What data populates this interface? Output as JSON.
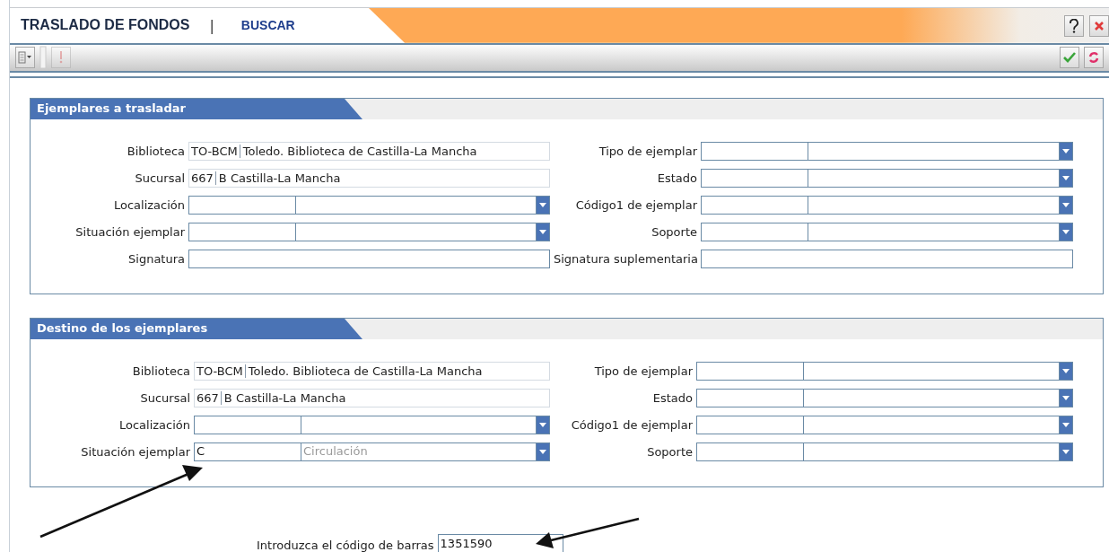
{
  "header": {
    "title": "TRASLADO DE FONDOS",
    "separator": "|",
    "link": "BUSCAR"
  },
  "sections": [
    {
      "title": "Ejemplares a trasladar",
      "left": [
        {
          "kind": "lookup",
          "label": "Biblioteca",
          "code": "TO-BCM",
          "value": "Toledo. Biblioteca de Castilla-La Mancha"
        },
        {
          "kind": "lookup",
          "label": "Sucursal",
          "code": "667",
          "value": "B Castilla-La Mancha"
        },
        {
          "kind": "combo",
          "label": "Localización"
        },
        {
          "kind": "combo",
          "label": "Situación ejemplar"
        },
        {
          "kind": "text",
          "label": "Signatura"
        }
      ],
      "right": [
        {
          "kind": "combo",
          "label": "Tipo de ejemplar"
        },
        {
          "kind": "combo",
          "label": "Estado"
        },
        {
          "kind": "combo",
          "label": "Código1 de ejemplar"
        },
        {
          "kind": "combo",
          "label": "Soporte"
        },
        {
          "kind": "text",
          "label": "Signatura suplementaria"
        }
      ]
    },
    {
      "title": "Destino de los ejemplares",
      "left": [
        {
          "kind": "lookup",
          "label": "Biblioteca",
          "code": "TO-BCM",
          "value": "Toledo. Biblioteca de Castilla-La Mancha"
        },
        {
          "kind": "lookup",
          "label": "Sucursal",
          "code": "667",
          "value": "B Castilla-La Mancha"
        },
        {
          "kind": "combo",
          "label": "Localización"
        },
        {
          "kind": "combo",
          "label": "Situación ejemplar",
          "code": "C",
          "value": "Circulación"
        }
      ],
      "right": [
        {
          "kind": "combo",
          "label": "Tipo de ejemplar"
        },
        {
          "kind": "combo",
          "label": "Estado"
        },
        {
          "kind": "combo",
          "label": "Código1 de ejemplar"
        },
        {
          "kind": "combo",
          "label": "Soporte"
        }
      ]
    }
  ],
  "barcode": {
    "label": "Introduzca el código de barras",
    "value": "1351590"
  }
}
